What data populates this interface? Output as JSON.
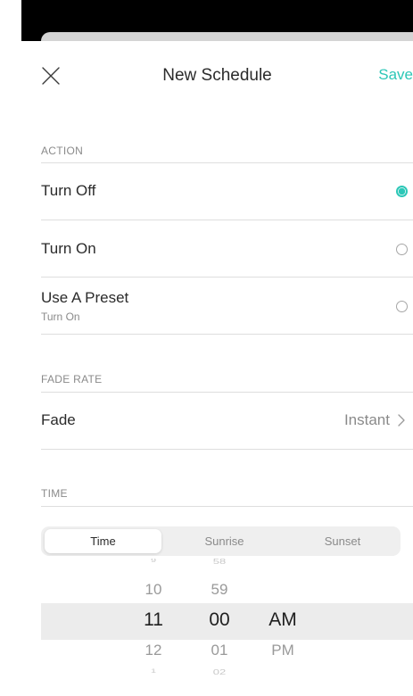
{
  "header": {
    "title": "New Schedule",
    "save_label": "Save",
    "close_icon": "close-icon"
  },
  "action": {
    "section_label": "ACTION",
    "options": [
      {
        "label": "Turn Off",
        "sublabel": "",
        "selected": true
      },
      {
        "label": "Turn On",
        "sublabel": "",
        "selected": false
      },
      {
        "label": "Use A Preset",
        "sublabel": "Turn On",
        "selected": false
      }
    ]
  },
  "fade_rate": {
    "section_label": "FADE RATE",
    "row_label": "Fade",
    "value": "Instant"
  },
  "time": {
    "section_label": "TIME",
    "segments": [
      "Time",
      "Sunrise",
      "Sunset"
    ],
    "active_segment": "Time",
    "picker": {
      "hours": [
        "9",
        "10",
        "11",
        "12",
        "1"
      ],
      "minutes": [
        "58",
        "59",
        "00",
        "01",
        "02"
      ],
      "periods": [
        "AM",
        "PM"
      ],
      "selected": {
        "hour": "11",
        "minute": "00",
        "period": "AM"
      }
    }
  },
  "colors": {
    "accent": "#2cc7b7",
    "text": "#2b2b2b",
    "secondary_text": "#8a8a8a",
    "divider": "#dedede",
    "picker_highlight": "#ececec"
  }
}
